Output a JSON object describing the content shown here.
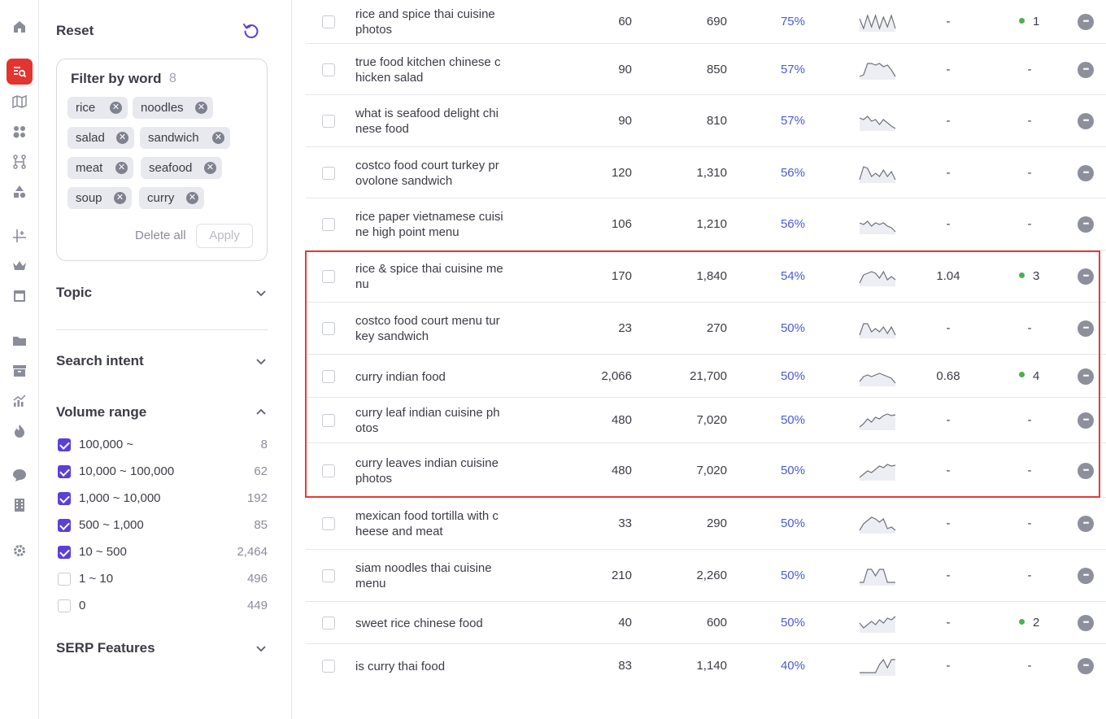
{
  "nav": {
    "icons": [
      "home-icon",
      "keyword-research-icon",
      "map-icon",
      "audience-icon",
      "workflow-icon",
      "shapes-icon",
      "crosshair-icon",
      "crown-icon",
      "browser-icon",
      "folder-icon",
      "archive-icon",
      "analytics-icon",
      "fire-icon",
      "chat-icon",
      "building-icon",
      "settings-icon"
    ],
    "active": "keyword-research-icon",
    "accent_color": "#e3342f"
  },
  "filters": {
    "reset_label": "Reset",
    "filter_by_word": {
      "title": "Filter by word",
      "count": "8",
      "words": [
        "rice",
        "noodles",
        "salad",
        "sandwich",
        "meat",
        "seafood",
        "soup",
        "curry"
      ],
      "delete_all_label": "Delete all",
      "apply_label": "Apply"
    },
    "topic_label": "Topic",
    "search_intent_label": "Search intent",
    "volume_range": {
      "title": "Volume range",
      "options": [
        {
          "label": "100,000 ~",
          "count": "8",
          "checked": true
        },
        {
          "label": "10,000 ~ 100,000",
          "count": "62",
          "checked": true
        },
        {
          "label": "1,000 ~ 10,000",
          "count": "192",
          "checked": true
        },
        {
          "label": "500 ~ 1,000",
          "count": "85",
          "checked": true
        },
        {
          "label": "10 ~ 500",
          "count": "2,464",
          "checked": true
        },
        {
          "label": "1 ~ 10",
          "count": "496",
          "checked": false
        },
        {
          "label": "0",
          "count": "449",
          "checked": false
        }
      ]
    },
    "serp_features_label": "SERP Features",
    "checkbox_color": "#5b3fd8"
  },
  "table": {
    "kd_color": "#4a5bd8",
    "rows": [
      {
        "keyword": "rice and spice thai cuisine photos",
        "col1": "60",
        "volume": "690",
        "kd": "75%",
        "trend": [
          0.7,
          0.1,
          0.9,
          0.2,
          0.9,
          0.1,
          0.8,
          0.2,
          0.9,
          0.1
        ],
        "cpc": "-",
        "results": "1",
        "dot": true
      },
      {
        "keyword": "true food kitchen chinese chicken salad",
        "col1": "90",
        "volume": "850",
        "kd": "57%",
        "trend": [
          0.1,
          0.2,
          0.9,
          0.9,
          0.8,
          0.9,
          0.7,
          0.8,
          0.5,
          0.1
        ],
        "cpc": "-",
        "results": "-",
        "dot": false
      },
      {
        "keyword": "what is seafood delight chinese food",
        "col1": "90",
        "volume": "810",
        "kd": "57%",
        "trend": [
          0.7,
          0.6,
          0.8,
          0.5,
          0.6,
          0.3,
          0.6,
          0.4,
          0.2,
          0.05
        ],
        "cpc": "-",
        "results": "-",
        "dot": false
      },
      {
        "keyword": "costco food court turkey provolone sandwich",
        "col1": "120",
        "volume": "1,310",
        "kd": "56%",
        "trend": [
          0.1,
          0.9,
          0.8,
          0.3,
          0.5,
          0.3,
          0.7,
          0.3,
          0.6,
          0.1
        ],
        "cpc": "-",
        "results": "-",
        "dot": false
      },
      {
        "keyword": "rice paper vietnamese cuisine high point menu",
        "col1": "106",
        "volume": "1,210",
        "kd": "56%",
        "trend": [
          0.6,
          0.5,
          0.7,
          0.4,
          0.6,
          0.5,
          0.6,
          0.4,
          0.3,
          0.05
        ],
        "cpc": "-",
        "results": "-",
        "dot": false
      },
      {
        "keyword": "rice & spice thai cuisine menu",
        "col1": "170",
        "volume": "1,840",
        "kd": "54%",
        "trend": [
          0.1,
          0.6,
          0.7,
          0.8,
          0.7,
          0.4,
          0.8,
          0.3,
          0.5,
          0.3
        ],
        "cpc": "1.04",
        "results": "3",
        "dot": true
      },
      {
        "keyword": "costco food court menu turkey sandwich",
        "col1": "23",
        "volume": "270",
        "kd": "50%",
        "trend": [
          0.1,
          0.8,
          0.8,
          0.3,
          0.5,
          0.3,
          0.6,
          0.2,
          0.6,
          0.1
        ],
        "cpc": "-",
        "results": "-",
        "dot": false
      },
      {
        "keyword": "curry indian food",
        "col1": "2,066",
        "volume": "21,700",
        "kd": "50%",
        "trend": [
          0.2,
          0.5,
          0.6,
          0.5,
          0.6,
          0.7,
          0.6,
          0.5,
          0.4,
          0.1
        ],
        "cpc": "0.68",
        "results": "4",
        "dot": true
      },
      {
        "keyword": "curry leaf indian cuisine photos",
        "col1": "480",
        "volume": "7,020",
        "kd": "50%",
        "trend": [
          0.1,
          0.3,
          0.6,
          0.4,
          0.7,
          0.6,
          0.8,
          0.9,
          0.8,
          0.85
        ],
        "cpc": "-",
        "results": "-",
        "dot": false
      },
      {
        "keyword": "curry leaves indian cuisine photos",
        "col1": "480",
        "volume": "7,020",
        "kd": "50%",
        "trend": [
          0.1,
          0.3,
          0.5,
          0.4,
          0.6,
          0.8,
          0.7,
          0.9,
          0.8,
          0.85
        ],
        "cpc": "-",
        "results": "-",
        "dot": false
      },
      {
        "keyword": "mexican food tortilla with cheese and meat",
        "col1": "33",
        "volume": "290",
        "kd": "50%",
        "trend": [
          0.1,
          0.5,
          0.7,
          0.9,
          0.8,
          0.6,
          0.8,
          0.2,
          0.3,
          0.1
        ],
        "cpc": "-",
        "results": "-",
        "dot": false
      },
      {
        "keyword": "siam noodles thai cuisine menu",
        "col1": "210",
        "volume": "2,260",
        "kd": "50%",
        "trend": [
          0.1,
          0.1,
          0.9,
          0.9,
          0.5,
          0.9,
          0.9,
          0.1,
          0.1,
          0.1
        ],
        "cpc": "-",
        "results": "-",
        "dot": false
      },
      {
        "keyword": "sweet rice chinese food",
        "col1": "40",
        "volume": "600",
        "kd": "50%",
        "trend": [
          0.5,
          0.2,
          0.4,
          0.6,
          0.4,
          0.7,
          0.5,
          0.8,
          0.7,
          0.9
        ],
        "cpc": "-",
        "results": "2",
        "dot": true
      },
      {
        "keyword": "is curry thai food",
        "col1": "83",
        "volume": "1,140",
        "kd": "40%",
        "trend": [
          0.1,
          0.1,
          0.1,
          0.1,
          0.1,
          0.6,
          0.9,
          0.4,
          0.9,
          0.9
        ],
        "cpc": "-",
        "results": "-",
        "dot": false
      }
    ]
  }
}
